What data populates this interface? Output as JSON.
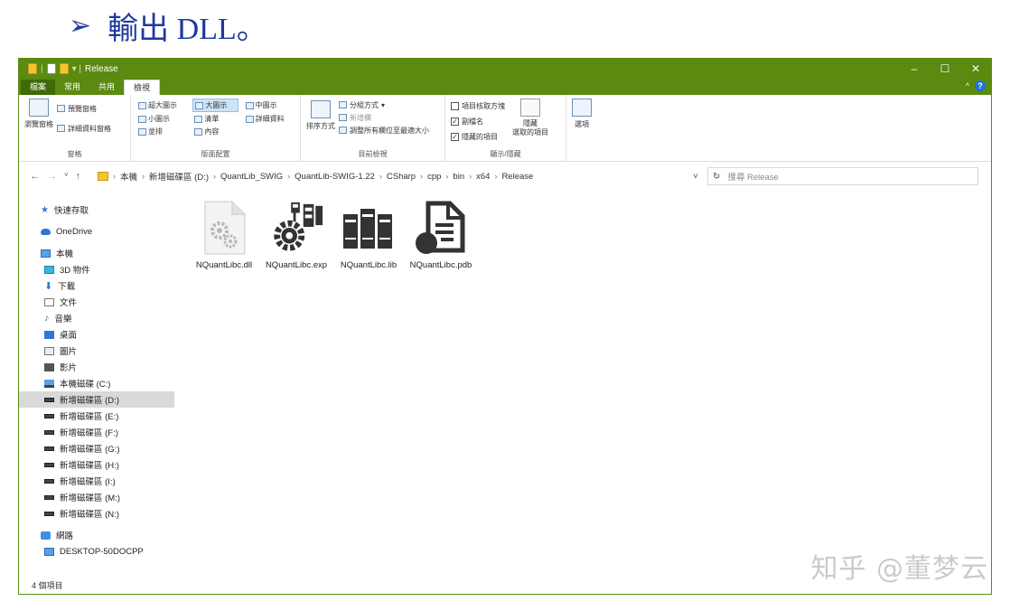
{
  "heading": {
    "bullet": "➢",
    "text": "輸出 DLL。"
  },
  "window": {
    "title": "Release",
    "controls": [
      "–",
      "☐",
      "✕"
    ]
  },
  "ribbon_tabs": {
    "file": "檔案",
    "home": "常用",
    "share": "共用",
    "view": "檢視"
  },
  "ribbon": {
    "panes": {
      "nav_pane": "瀏覽窗格",
      "preview_pane": "預覽窗格",
      "details_pane": "詳細資料窗格",
      "label": "窗格"
    },
    "layout": {
      "items": [
        "超大圖示",
        "大圖示",
        "中圖示",
        "小圖示",
        "清單",
        "詳細資料",
        "並排",
        "內容"
      ],
      "label": "版面配置"
    },
    "current_view": {
      "sort_by": "排序方式",
      "group_by": "分組方式",
      "add_columns": "新增欄",
      "size_columns": "調整所有欄位至最適大小",
      "label": "目前檢視"
    },
    "show_hide": {
      "item_checkboxes": "項目核取方塊",
      "file_extensions": "副檔名",
      "hidden_items": "隱藏的項目",
      "hide_selected": "隱藏\n選取的項目",
      "label": "顯示/隱藏"
    },
    "options": "選項"
  },
  "address": {
    "crumbs": [
      "本機",
      "新增磁碟區 (D:)",
      "QuantLib_SWIG",
      "QuantLib-SWIG-1.22",
      "CSharp",
      "cpp",
      "bin",
      "x64",
      "Release"
    ],
    "search_placeholder": "搜尋 Release"
  },
  "nav": {
    "quick_access": "快速存取",
    "onedrive": "OneDrive",
    "this_pc": "本機",
    "objects3d": "3D 物件",
    "downloads": "下載",
    "documents": "文件",
    "music": "音樂",
    "desktop": "桌面",
    "pictures": "圖片",
    "videos": "影片",
    "drive_c": "本機磁碟 (C:)",
    "drive_d": "新增磁碟區 (D:)",
    "drive_e": "新增磁碟區 (E:)",
    "drive_f": "新增磁碟區 (F:)",
    "drive_g": "新增磁碟區 (G:)",
    "drive_h": "新增磁碟區 (H:)",
    "drive_i": "新增磁碟區 (I:)",
    "drive_m": "新增磁碟區 (M:)",
    "drive_n": "新增磁碟區 (N:)",
    "network": "網路",
    "desktop_pc": "DESKTOP-50DOCPP"
  },
  "files": [
    {
      "name": "NQuantLibc.dll",
      "icon": "dll-gear-icon"
    },
    {
      "name": "NQuantLibc.exp",
      "icon": "exp-gear-icon"
    },
    {
      "name": "NQuantLibc.lib",
      "icon": "lib-books-icon"
    },
    {
      "name": "NQuantLibc.pdb",
      "icon": "pdb-document-icon"
    }
  ],
  "status": "4 個項目",
  "watermark": "知乎 @董梦云",
  "colors": {
    "titlebar": "#5a8a10",
    "heading": "#1f3a9e",
    "selection": "#d9d9d9"
  }
}
